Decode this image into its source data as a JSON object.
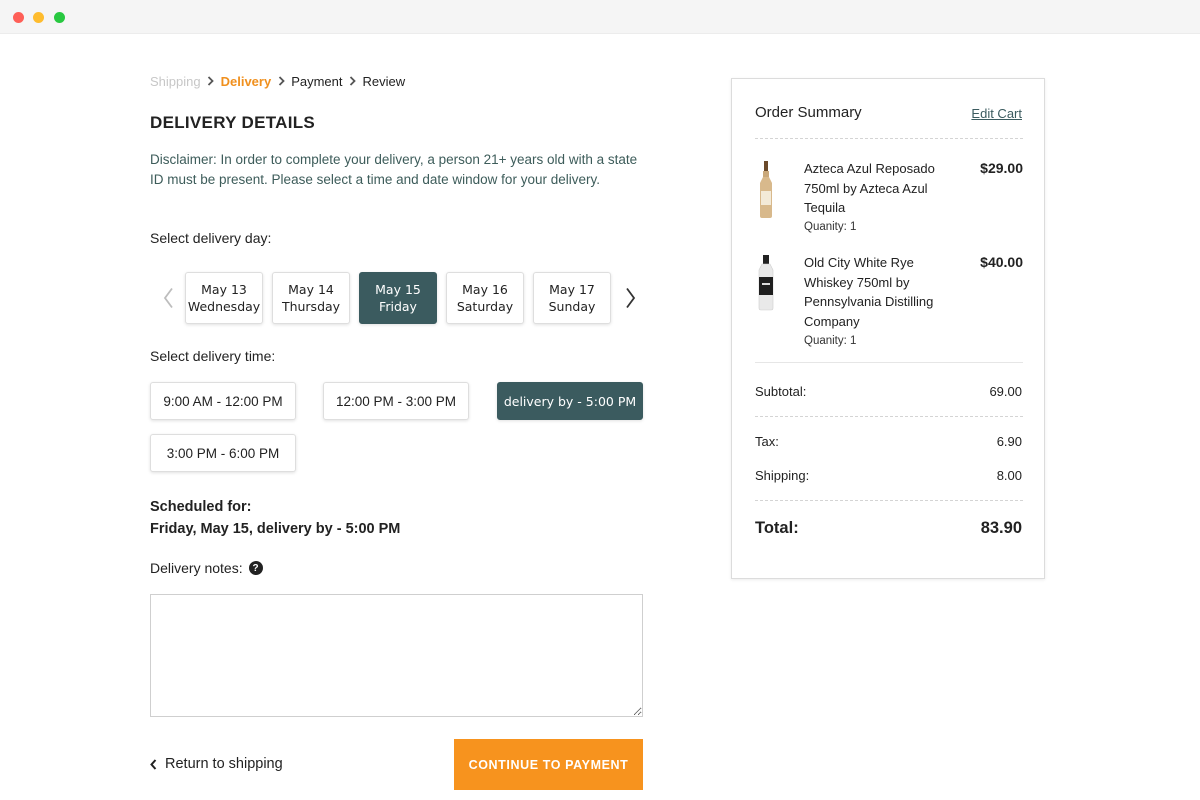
{
  "breadcrumb": {
    "steps": [
      "Shipping",
      "Delivery",
      "Payment",
      "Review"
    ]
  },
  "delivery": {
    "title": "DELIVERY DETAILS",
    "disclaimer": "Disclaimer: In order to complete your delivery, a person 21+ years old with a state ID must be present. Please select a time and date window for your delivery.",
    "day_label": "Select delivery day:",
    "days": [
      {
        "date": "May 13",
        "weekday": "Wednesday",
        "selected": false
      },
      {
        "date": "May 14",
        "weekday": "Thursday",
        "selected": false
      },
      {
        "date": "May 15",
        "weekday": "Friday",
        "selected": true
      },
      {
        "date": "May 16",
        "weekday": "Saturday",
        "selected": false
      },
      {
        "date": "May 17",
        "weekday": "Sunday",
        "selected": false
      }
    ],
    "time_label": "Select delivery time:",
    "times": [
      {
        "label": "9:00 AM - 12:00 PM",
        "selected": false
      },
      {
        "label": "12:00 PM - 3:00 PM",
        "selected": false
      },
      {
        "label": "delivery by - 5:00 PM",
        "selected": true
      },
      {
        "label": "3:00 PM - 6:00 PM",
        "selected": false
      }
    ],
    "scheduled_label": "Scheduled for:",
    "scheduled_value": "Friday, May 15, delivery by - 5:00 PM",
    "notes_label": "Delivery notes:",
    "notes_value": "",
    "return_link": "Return to shipping",
    "continue_button": "CONTINUE TO PAYMENT"
  },
  "summary": {
    "title": "Order Summary",
    "edit_cart": "Edit Cart",
    "items": [
      {
        "name": "Azteca Azul Reposado 750ml by Azteca Azul Tequila",
        "quantity": "Quanity: 1",
        "price": "$29.00",
        "icon": "tequila-bottle-icon"
      },
      {
        "name": "Old City White Rye Whiskey 750ml by Pennsylvania Distilling Company",
        "quantity": "Quanity: 1",
        "price": "$40.00",
        "icon": "whiskey-bottle-icon"
      }
    ],
    "subtotal_label": "Subtotal:",
    "subtotal_value": "69.00",
    "tax_label": "Tax:",
    "tax_value": "6.90",
    "shipping_label": "Shipping:",
    "shipping_value": "8.00",
    "total_label": "Total:",
    "total_value": "83.90"
  },
  "colors": {
    "accent_orange": "#f7931e",
    "selected_teal": "#3b5b5f",
    "disclaimer_text": "#3d5c5a"
  }
}
